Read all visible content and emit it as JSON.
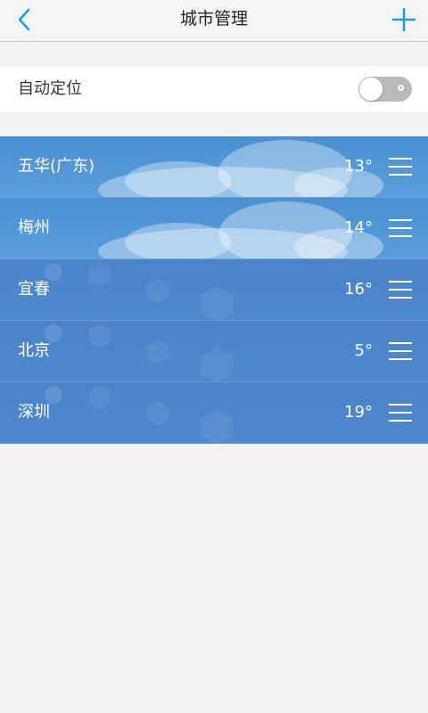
{
  "header": {
    "title": "城市管理",
    "back_icon": "back-arrow-icon",
    "add_icon": "plus-icon"
  },
  "auto_locate": {
    "label": "自动定位",
    "enabled": false
  },
  "cities": [
    {
      "name": "五华(广东)",
      "temp": "13°",
      "style": "cloudy"
    },
    {
      "name": "梅州",
      "temp": "14°",
      "style": "cloudy"
    },
    {
      "name": "宜春",
      "temp": "16°",
      "style": "clear"
    },
    {
      "name": "北京",
      "temp": "5°",
      "style": "clear"
    },
    {
      "name": "深圳",
      "temp": "19°",
      "style": "clear"
    }
  ],
  "colors": {
    "accent": "#1a9be8",
    "cloudy_bg": "#4a90d3",
    "clear_bg": "#4b83c9"
  }
}
